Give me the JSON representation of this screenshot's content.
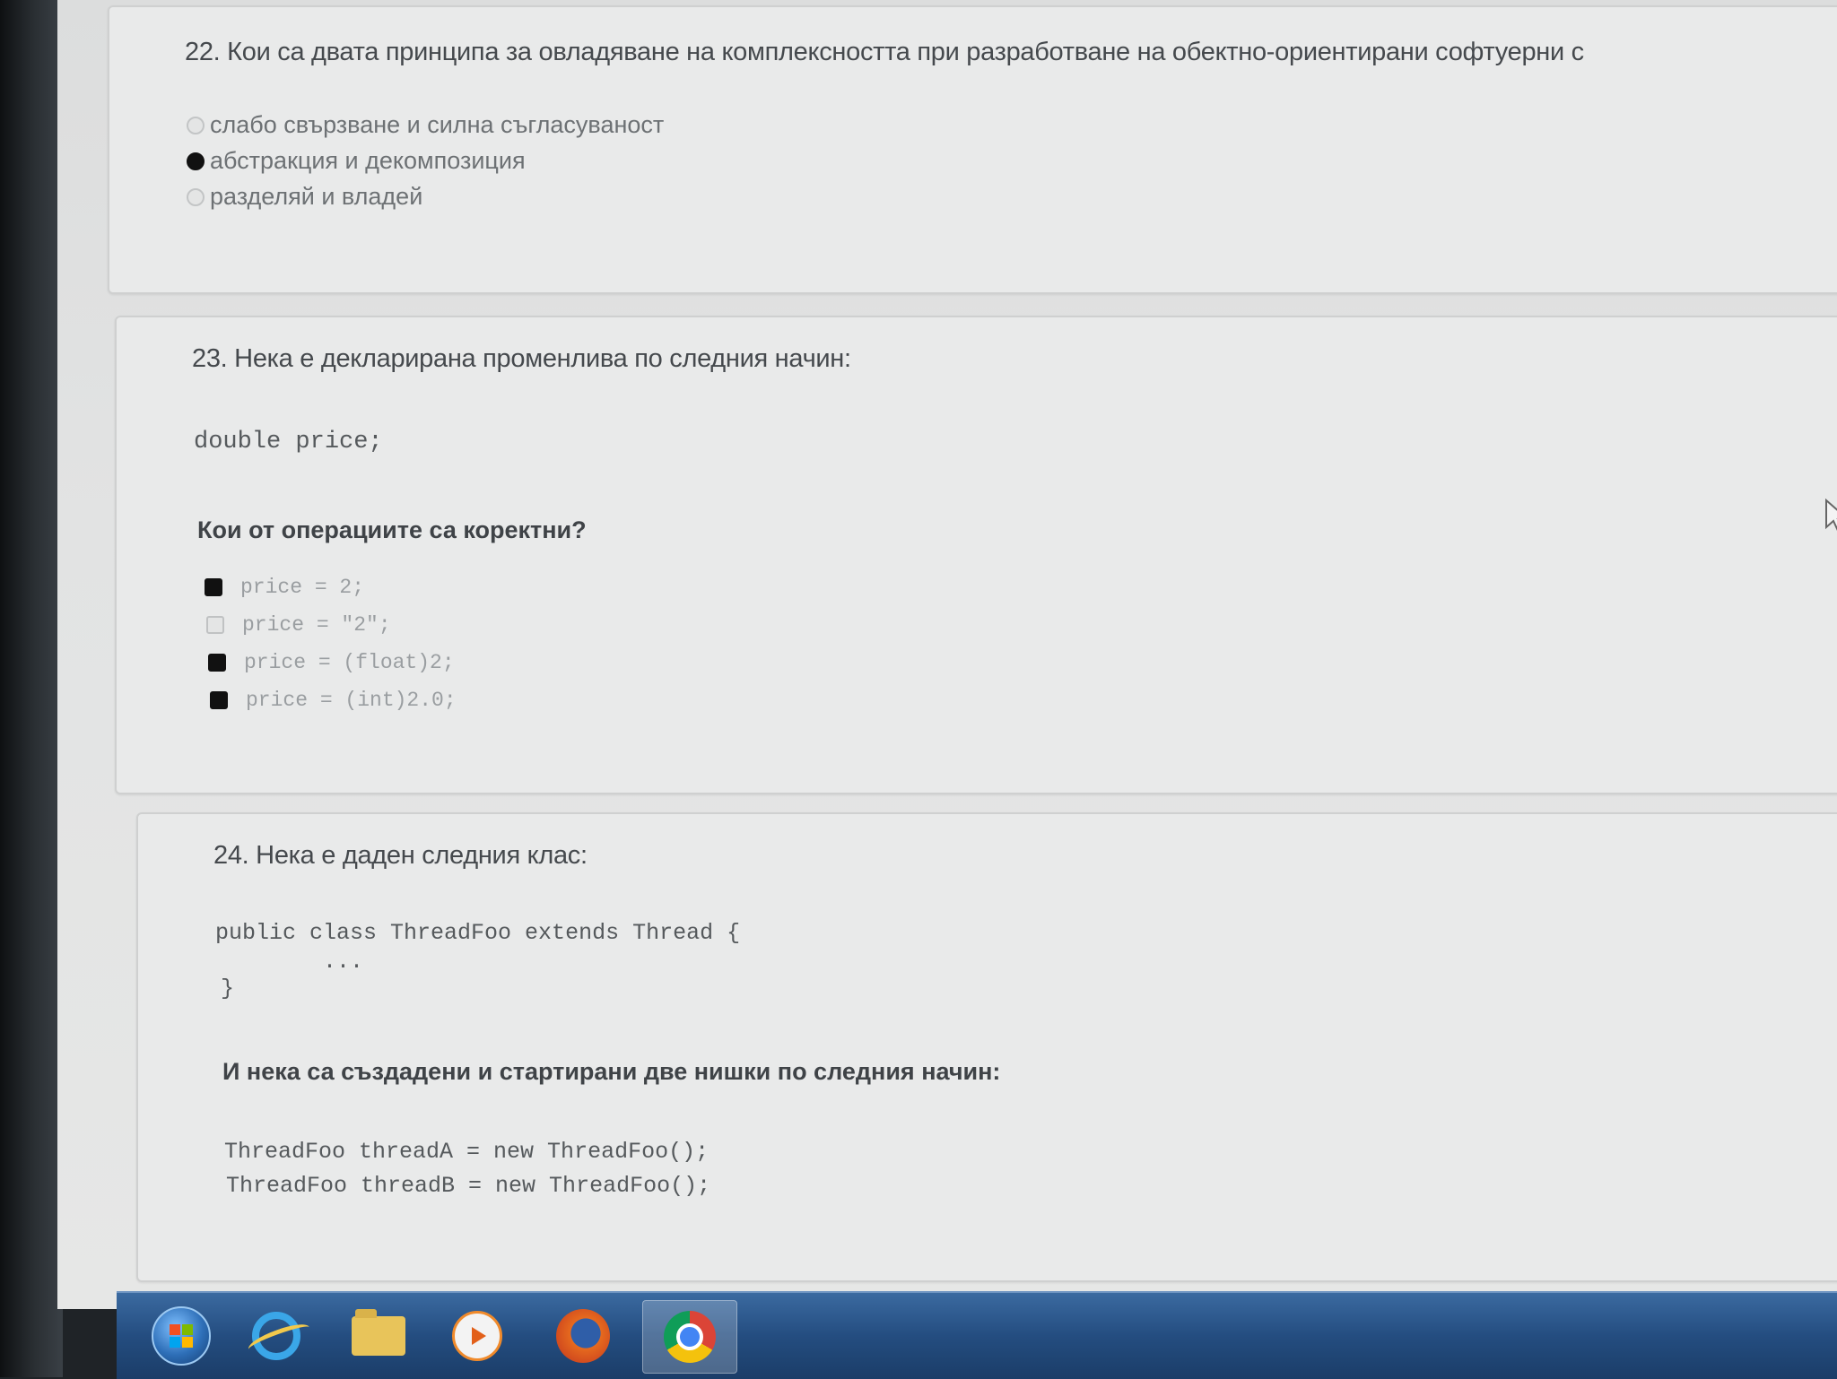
{
  "questions": [
    {
      "title": "22. Кои са двата принципа за овладяване на комплексността при разработване на обектно-ориентирани софтуерни с",
      "options": [
        {
          "label": "слабо свързване и силна съгласуваност",
          "checked": false
        },
        {
          "label": "абстракция и декомпозиция",
          "checked": true
        },
        {
          "label": "разделяй и владей",
          "checked": false
        }
      ]
    },
    {
      "title": "23. Нека е декларирана променлива по следния начин:",
      "code": "double price;",
      "prompt": "Кои от операциите са коректни?",
      "options": [
        {
          "label": "price = 2;",
          "checked": true
        },
        {
          "label": "price = \"2\";",
          "checked": false
        },
        {
          "label": "price = (float)2;",
          "checked": true
        },
        {
          "label": "price = (int)2.0;",
          "checked": true
        }
      ]
    },
    {
      "title": "24. Нека е даден следния клас:",
      "code_lines": [
        "public class ThreadFoo extends Thread {",
        "        ...",
        "}"
      ],
      "prompt": "И нека са създадени и стартирани две нишки по следния начин:",
      "code2_lines": [
        "ThreadFoo threadA = new ThreadFoo();",
        "ThreadFoo threadB = new ThreadFoo();"
      ]
    }
  ],
  "taskbar": {
    "items": [
      "windows-start",
      "internet-explorer",
      "file-explorer",
      "media-player",
      "firefox",
      "chrome"
    ],
    "active": "chrome"
  },
  "colors": {
    "page_bg": "#e6e7e6",
    "card_bg": "#e9eaea",
    "title_text": "#45494d",
    "option_text": "#6d7174",
    "taskbar": "#244d80"
  }
}
